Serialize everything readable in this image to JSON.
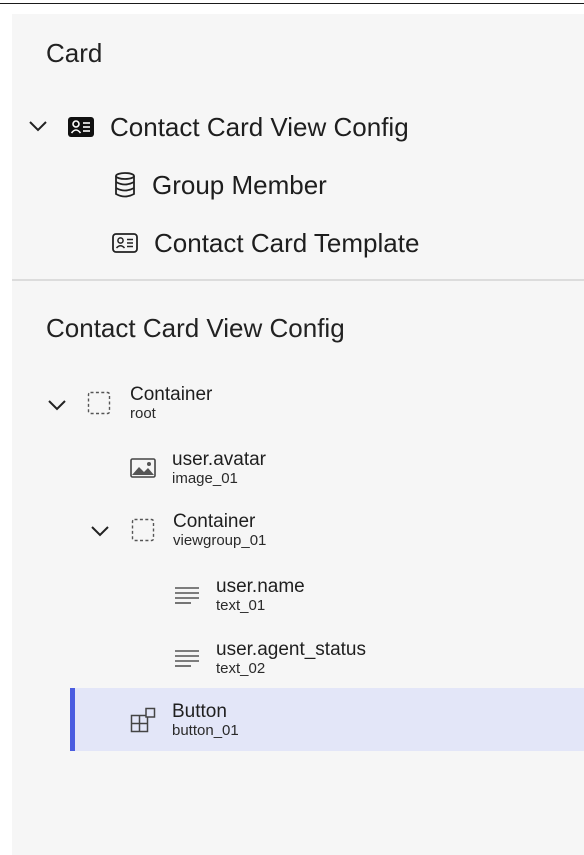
{
  "colors": {
    "panel_bg": "#f6f6f6",
    "selected_bg": "#e3e6f8",
    "selected_accent": "#4a5ce0"
  },
  "top": {
    "section_title": "Card",
    "tree": [
      {
        "label": "Contact Card View Config",
        "icon": "contact-card-icon",
        "expanded": true
      },
      {
        "label": "Group Member",
        "icon": "database-icon"
      },
      {
        "label": "Contact Card Template",
        "icon": "contact-card-outline-icon"
      }
    ]
  },
  "bottom": {
    "section_title": "Contact Card View Config",
    "tree": [
      {
        "title": "Container",
        "subtitle": "root",
        "icon": "container-icon",
        "expanded": true
      },
      {
        "title": "user.avatar",
        "subtitle": "image_01",
        "icon": "image-icon"
      },
      {
        "title": "Container",
        "subtitle": "viewgroup_01",
        "icon": "container-icon",
        "expanded": true
      },
      {
        "title": "user.name",
        "subtitle": "text_01",
        "icon": "text-lines-icon"
      },
      {
        "title": "user.agent_status",
        "subtitle": "text_02",
        "icon": "text-lines-icon"
      },
      {
        "title": "Button",
        "subtitle": "button_01",
        "icon": "button-component-icon",
        "selected": true
      }
    ]
  }
}
